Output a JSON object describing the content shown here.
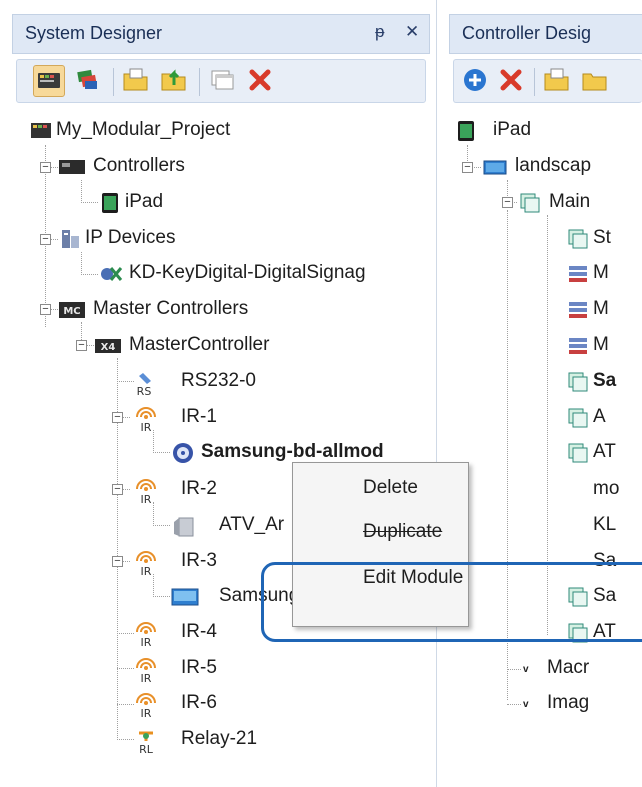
{
  "left_panel": {
    "title": "System Designer",
    "pin_glyph": "ᵽ",
    "close_glyph": "✕",
    "toolbar_icons": [
      "system-view-icon",
      "modules-icon",
      "open-folder-icon",
      "export-folder-icon",
      "windows-icon",
      "delete-icon"
    ],
    "tree": {
      "project": "My_Modular_Project",
      "controllers": "Controllers",
      "ipad": "iPad",
      "ip_devices": "IP Devices",
      "kd_device": "KD-KeyDigital-DigitalSignag",
      "master_controllers": "Master Controllers",
      "master_controller": "MasterController",
      "rs232": "RS232-0",
      "ir1": "IR-1",
      "samsung_bd": "Samsung-bd-allmod",
      "ir2": "IR-2",
      "atv": "ATV_Ar",
      "ir3": "IR-3",
      "samsung_tv": "Samsung-tv-All_mot",
      "ir4": "IR-4",
      "ir5": "IR-5",
      "ir6": "IR-6",
      "relay": "Relay-21"
    },
    "icon_text": {
      "rs": "RS",
      "ir": "IR",
      "rl": "RL",
      "mc": "MC",
      "x4": "X4"
    }
  },
  "right_panel": {
    "title": "Controller Desig",
    "toolbar_icons": [
      "add-icon",
      "delete-icon",
      "open-folder-icon",
      "export-folder-icon"
    ],
    "tree": {
      "ipad": "iPad",
      "landscape": "landscap",
      "main": "Main",
      "st": "St",
      "m1": "M",
      "m2": "M",
      "m3": "M",
      "sa_bold": "Sa",
      "a": "A",
      "at": "AT",
      "mo": "mo",
      "kl": "KL",
      "sa1": "Sa",
      "sa2": "Sa",
      "at2": "AT",
      "macro": "Macr",
      "image": "Imag",
      "v_label": "v"
    }
  },
  "context_menu": {
    "items": [
      "Delete",
      "Duplicate",
      "Edit Module"
    ]
  },
  "colors": {
    "header_bg": "#dfe8f5",
    "toolbar_bg": "#e8eef7",
    "highlight_border": "#1f65b5",
    "menu_bg": "#f5f5f5"
  }
}
